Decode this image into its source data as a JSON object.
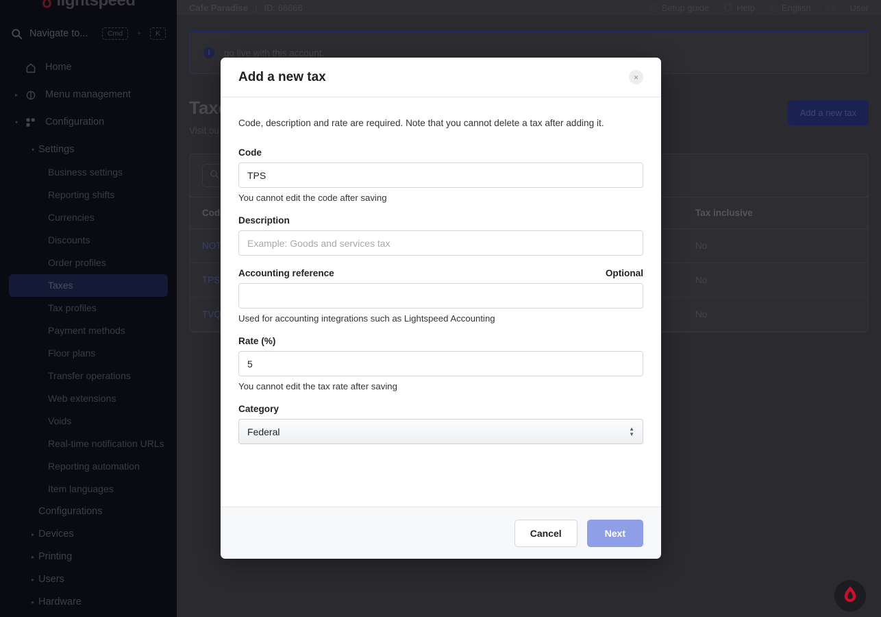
{
  "sidebar": {
    "logo_text": "lightspeed",
    "search": {
      "label": "Navigate to...",
      "key_cmd": "Cmd",
      "key_plus": "+",
      "key_k": "K"
    },
    "items": [
      {
        "label": "Home",
        "level": "top",
        "icon": "home-icon",
        "caret": "",
        "active": false
      },
      {
        "label": "Menu management",
        "level": "top",
        "icon": "menu-management-icon",
        "caret": "▸",
        "active": false
      },
      {
        "label": "Configuration",
        "level": "top",
        "icon": "configuration-icon",
        "caret": "▾",
        "active": false
      },
      {
        "label": "Settings",
        "level": "lvl1",
        "icon": "",
        "caret": "▾",
        "active": false
      },
      {
        "label": "Business settings",
        "level": "lvl2",
        "icon": "",
        "caret": "",
        "active": false
      },
      {
        "label": "Reporting shifts",
        "level": "lvl2",
        "icon": "",
        "caret": "",
        "active": false
      },
      {
        "label": "Currencies",
        "level": "lvl2",
        "icon": "",
        "caret": "",
        "active": false
      },
      {
        "label": "Discounts",
        "level": "lvl2",
        "icon": "",
        "caret": "",
        "active": false
      },
      {
        "label": "Order profiles",
        "level": "lvl2",
        "icon": "",
        "caret": "",
        "active": false
      },
      {
        "label": "Taxes",
        "level": "lvl2",
        "icon": "",
        "caret": "",
        "active": true
      },
      {
        "label": "Tax profiles",
        "level": "lvl2",
        "icon": "",
        "caret": "",
        "active": false
      },
      {
        "label": "Payment methods",
        "level": "lvl2",
        "icon": "",
        "caret": "",
        "active": false
      },
      {
        "label": "Floor plans",
        "level": "lvl2",
        "icon": "",
        "caret": "",
        "active": false
      },
      {
        "label": "Transfer operations",
        "level": "lvl2",
        "icon": "",
        "caret": "",
        "active": false
      },
      {
        "label": "Web extensions",
        "level": "lvl2",
        "icon": "",
        "caret": "",
        "active": false
      },
      {
        "label": "Voids",
        "level": "lvl2",
        "icon": "",
        "caret": "",
        "active": false
      },
      {
        "label": "Real-time notification URLs",
        "level": "lvl2",
        "icon": "",
        "caret": "",
        "active": false
      },
      {
        "label": "Reporting automation",
        "level": "lvl2",
        "icon": "",
        "caret": "",
        "active": false
      },
      {
        "label": "Item languages",
        "level": "lvl2",
        "icon": "",
        "caret": "",
        "active": false
      },
      {
        "label": "Configurations",
        "level": "lvl1",
        "icon": "",
        "caret": "",
        "active": false
      },
      {
        "label": "Devices",
        "level": "lvl1",
        "icon": "",
        "caret": "▸",
        "active": false
      },
      {
        "label": "Printing",
        "level": "lvl1",
        "icon": "",
        "caret": "▸",
        "active": false
      },
      {
        "label": "Users",
        "level": "lvl1",
        "icon": "",
        "caret": "▸",
        "active": false
      },
      {
        "label": "Hardware",
        "level": "lvl1",
        "icon": "",
        "caret": "▸",
        "active": false
      }
    ]
  },
  "topbar": {
    "business_name": "Cafe Paradise",
    "separator": "|",
    "account_id": "ID: 66666",
    "setup_guide": "Setup guide",
    "help": "Help",
    "language": "English",
    "user": "User"
  },
  "banner": {
    "icon": "info-icon",
    "text": "go live with this account."
  },
  "page": {
    "title": "Taxes",
    "subtitle": "Visit ou",
    "add_button": "Add a new tax"
  },
  "table": {
    "search_placeholder": "",
    "columns": [
      "Code",
      "Tax inclusive"
    ],
    "rows": [
      {
        "code": "NOT",
        "tax_inclusive": "No"
      },
      {
        "code": "TPS",
        "tax_inclusive": "No"
      },
      {
        "code": "TVQ",
        "tax_inclusive": "No"
      }
    ]
  },
  "modal": {
    "title": "Add a new tax",
    "close_icon": "×",
    "intro": "Code, description and rate are required. Note that you cannot delete a tax after adding it.",
    "fields": {
      "code": {
        "label": "Code",
        "value": "TPS",
        "placeholder": "",
        "help": "You cannot edit the code after saving"
      },
      "description": {
        "label": "Description",
        "value": "",
        "placeholder": "Example: Goods and services tax",
        "help": ""
      },
      "accounting_reference": {
        "label": "Accounting reference",
        "optional_label": "Optional",
        "value": "",
        "placeholder": "",
        "help": "Used for accounting integrations such as Lightspeed Accounting"
      },
      "rate": {
        "label": "Rate (%)",
        "value": "5",
        "placeholder": "",
        "help": "You cannot edit the tax rate after saving"
      },
      "category": {
        "label": "Category",
        "value": "Federal",
        "options": [
          "Federal"
        ]
      }
    },
    "cancel_label": "Cancel",
    "next_label": "Next"
  },
  "fab": {
    "icon": "lightspeed-flame-icon"
  },
  "colors": {
    "sidebar_bg": "#0a0a12",
    "sidebar_active": "#141936",
    "modal_bg": "#ffffff",
    "next_button": "#8e9fe8",
    "brand_red": "#c8102e",
    "overlay": "rgba(0,0,0,0.55)"
  }
}
